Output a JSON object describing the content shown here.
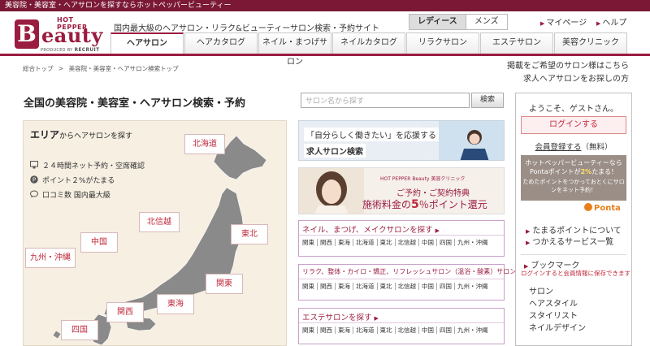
{
  "topbar": {
    "text": "美容院・美容室・ヘアサロンを探すならホットペッパービューティー"
  },
  "logo": {
    "hot_pepper": "HOT PEPPER",
    "b": "B",
    "eauty": "eauty",
    "produced": "PRODUCED BY",
    "recruit": "RECRUIT"
  },
  "header": {
    "tagline": "国内最大級のヘアサロン・リラク&ビューティーサロン検索・予約サイト",
    "gender": {
      "ladies": "レディース",
      "mens": "メンズ"
    },
    "mypage": "マイページ",
    "help": "ヘルプ"
  },
  "nav": {
    "tabs": [
      {
        "label": "ヘアサロン"
      },
      {
        "label": "ヘアカタログ"
      },
      {
        "label": "ネイル・まつげサロン"
      },
      {
        "label": "ネイルカタログ"
      },
      {
        "label": "リラクサロン"
      },
      {
        "label": "エステサロン"
      },
      {
        "label": "美容クリニック"
      }
    ]
  },
  "breadcrumb": {
    "home": "総合トップ",
    "sep": ">",
    "current": "美容院・美容室・ヘアサロン検索トップ"
  },
  "right_links": {
    "line1": "掲載をご希望のサロン様はこちら",
    "line2": "求人ヘアサロンをお探しの方"
  },
  "headline": "全国の美容院・美容室・ヘアサロン検索・予約",
  "search": {
    "placeholder": "サロン名から探す",
    "button": "検索"
  },
  "area": {
    "title_main": "エリア",
    "title_rest": "からヘアサロンを探す",
    "features": [
      "２４時間ネット予約・空席確認",
      "ポイント２%がたまる",
      "口コミ数 国内最大級"
    ],
    "regions": {
      "hokkaido": "北海道",
      "tohoku": "東北",
      "hokushinetsu": "北信越",
      "kanto": "関東",
      "tokai": "東海",
      "kansai": "関西",
      "chugoku": "中国",
      "shikoku": "四国",
      "kyushu": "九州・沖縄"
    }
  },
  "promo1": {
    "line1": "「自分らしく働きたい」を応援する",
    "line2": "求人サロン検索"
  },
  "promo2": {
    "brand": "HOT PEPPER Beauty 美容クリニック",
    "line1": "ご予約・ご契約特典",
    "line2_pre": "施術料金の",
    "line2_num": "5",
    "line2_post": "％ポイント還元"
  },
  "categories": [
    {
      "title": "ネイル、まつげ、メイクサロンを探す",
      "areas": [
        "関東",
        "関西",
        "東海",
        "北海道",
        "東北",
        "北信越",
        "中国",
        "四国",
        "九州・沖縄"
      ]
    },
    {
      "title": "リラク、整体・カイロ・矯正、リフレッシュサロン（温浴・酸素）サロンを探す",
      "areas": [
        "関東",
        "関西",
        "東海",
        "北海道",
        "東北",
        "北信越",
        "中国",
        "四国",
        "九州・沖縄"
      ]
    },
    {
      "title": "エステサロンを探す",
      "areas": [
        "関東",
        "関西",
        "東海",
        "北海道",
        "東北",
        "北信越",
        "中国",
        "四国",
        "九州・沖縄"
      ]
    }
  ],
  "sidebar": {
    "welcome": "ようこそ、ゲストさん。",
    "login": "ログインする",
    "register": "会員登録する",
    "register_note": "（無料）",
    "points_line1": "ホットペッパービューティーなら",
    "points_line2_pre": "Pontaポイントが",
    "points_pct": "2%",
    "points_line2_post": "たまる！",
    "points_line3": "ためたポイントをつかっておとくにサロンをネット予約！",
    "ponta": "Ponta",
    "link1": "たまるポイントについて",
    "link2": "つかえるサービス一覧",
    "bookmark_title": "ブックマーク",
    "bookmark_note": "ログインすると会員情報に保存できます",
    "bookmark_items": [
      "サロン",
      "ヘアスタイル",
      "スタイリスト",
      "ネイルデザイン"
    ]
  },
  "colors": {
    "brand": "#9a1c40",
    "accent_red": "#c0283a",
    "map_fill": "#8a8a8a"
  }
}
